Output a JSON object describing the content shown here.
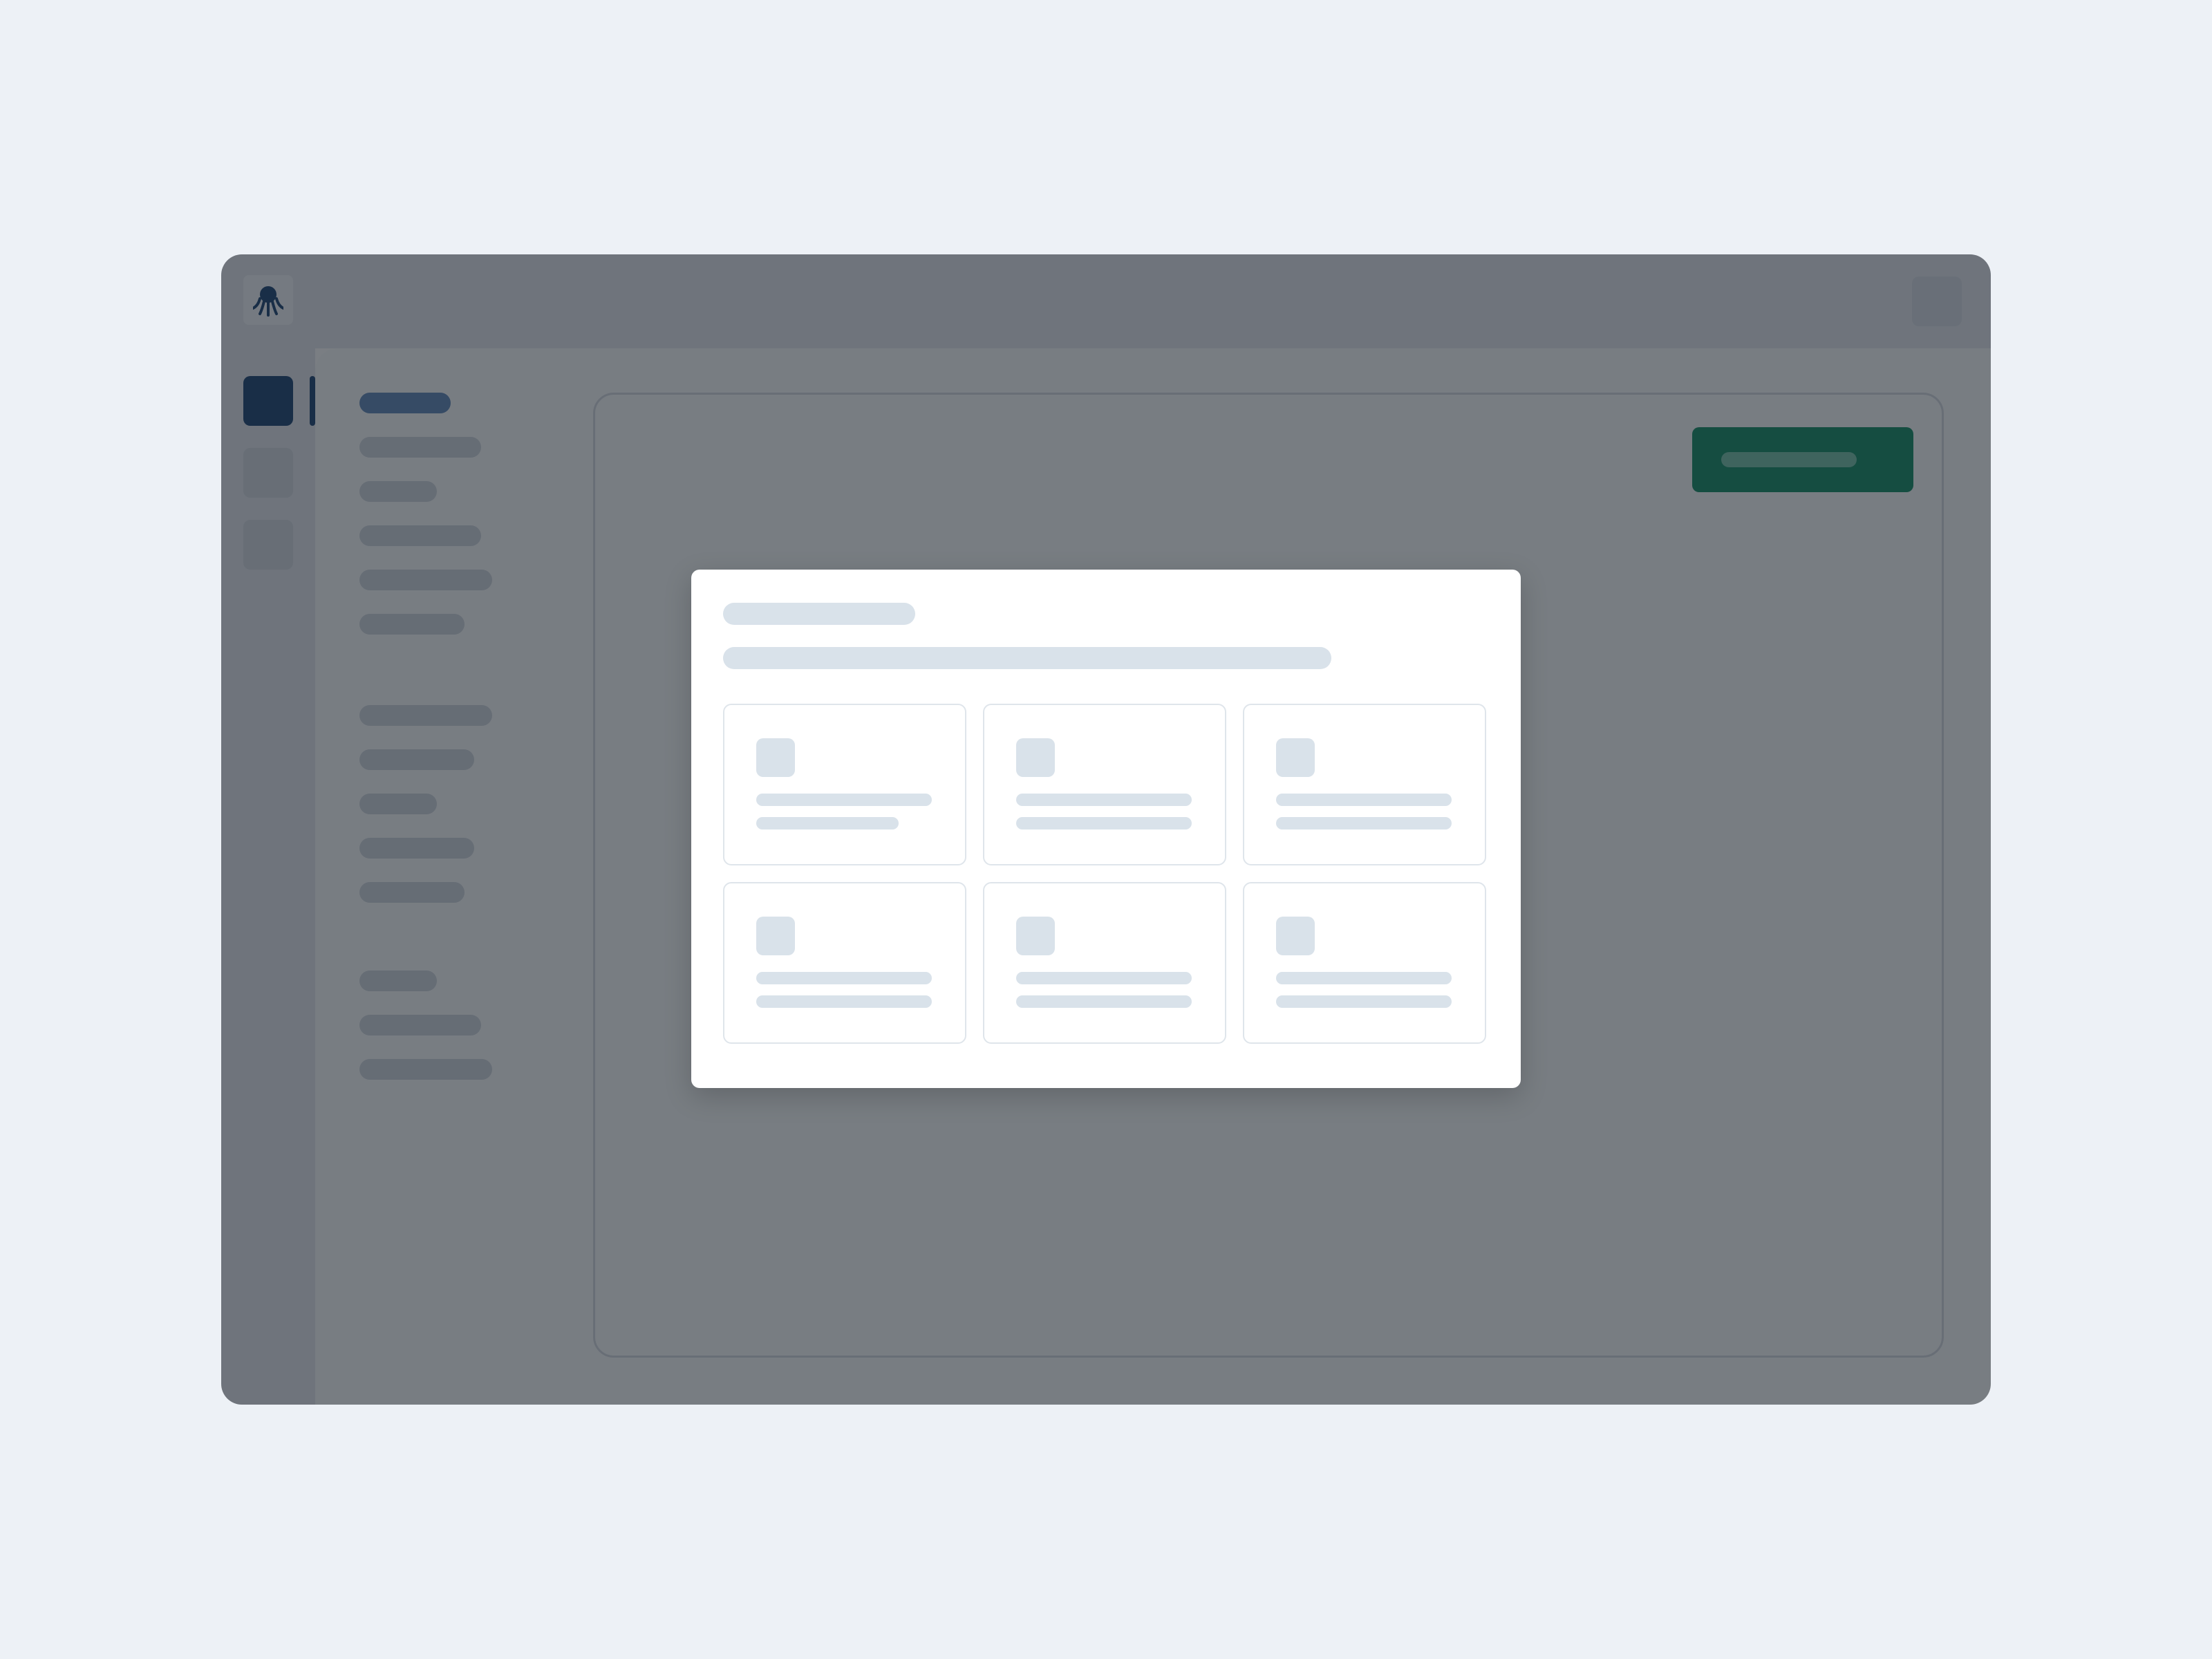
{
  "app": {
    "logo_icon": "octopus-logo-icon",
    "brand_color": "#1a4170",
    "primary_button_color": "#0f8a62",
    "overlay": "modal-backdrop"
  },
  "topbar": {
    "right_button_icon": "placeholder-icon"
  },
  "icon_rail": {
    "items": [
      {
        "name": "rail-item-1",
        "active": true
      },
      {
        "name": "rail-item-2",
        "active": false
      },
      {
        "name": "rail-item-3",
        "active": false
      }
    ],
    "avatar": "user-avatar"
  },
  "sidebar": {
    "groups": [
      {
        "items": [
          {
            "active": true
          },
          {},
          {},
          {},
          {},
          {}
        ]
      },
      {
        "items": [
          {},
          {},
          {},
          {},
          {}
        ]
      },
      {
        "items": [
          {},
          {},
          {}
        ]
      }
    ]
  },
  "modal": {
    "title": "",
    "subtitle": "",
    "options": [
      {
        "icon": "option-icon"
      },
      {
        "icon": "option-icon"
      },
      {
        "icon": "option-icon"
      },
      {
        "icon": "option-icon"
      },
      {
        "icon": "option-icon"
      },
      {
        "icon": "option-icon"
      }
    ]
  }
}
